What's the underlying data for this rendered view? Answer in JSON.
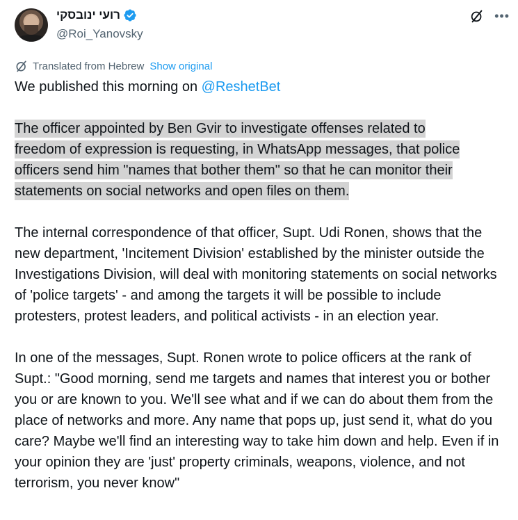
{
  "author": {
    "display_name": "רועי ינובסקי",
    "handle": "@Roi_Yanovsky"
  },
  "translation": {
    "label": "Translated from Hebrew",
    "show_original": "Show original"
  },
  "tweet": {
    "intro_text": "We published this morning on ",
    "intro_mention": "@ReshetBet",
    "paragraph_1_lines": [
      "The officer appointed by Ben Gvir to investigate offenses related to",
      "freedom of expression is requesting, in WhatsApp messages, that police",
      "officers send him \"names that bother them\" so that he can monitor their",
      "statements on social networks and open files on them."
    ],
    "paragraph_2": "The internal correspondence of that officer, Supt. Udi Ronen, shows that the new department, 'Incitement Division' established by the minister outside the Investigations Division, will deal with monitoring statements on social networks of 'police targets' - and among the targets it will be possible to include protesters, protest leaders, and political activists - in an election year.",
    "paragraph_3": "In one of the messages, Supt. Ronen wrote to police officers at the rank of Supt.: \"Good morning, send me targets and names that interest you or bother you or are known to you. We'll see what and if we can do about them from the place of networks and more. Any name that pops up, just send it, what do you care? Maybe we'll find an interesting way to take him down and help. Even if in your opinion they are 'just' property criminals, weapons, violence, and not terrorism, you never know\""
  },
  "icons": {
    "verified": "verified-badge-icon",
    "grok": "grok-icon",
    "more": "more-icon",
    "translate": "translate-icon"
  },
  "colors": {
    "accent": "#1d9bf0",
    "secondary_text": "#536471",
    "highlight": "#d3d3d3"
  }
}
